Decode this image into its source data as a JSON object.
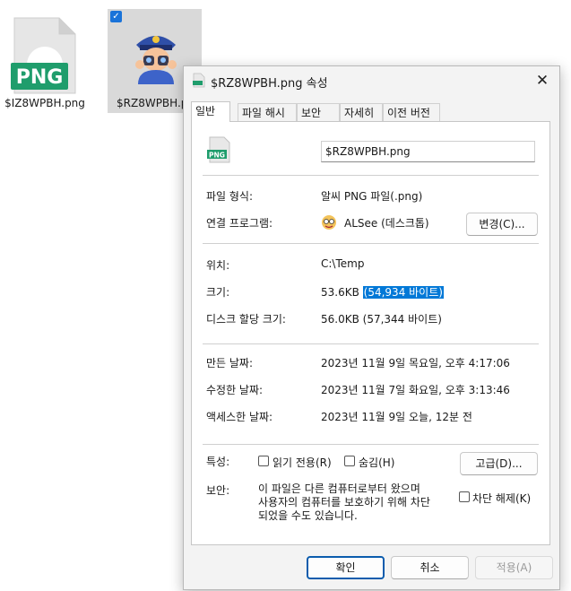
{
  "desktop": {
    "files": [
      {
        "name": "$IZ8WPBH.png",
        "badge": "PNG"
      },
      {
        "name": "$RZ8WPBH.png",
        "selected": true
      }
    ]
  },
  "dialog": {
    "title": "$RZ8WPBH.png 속성",
    "tabs": [
      {
        "label": "일반",
        "active": true
      },
      {
        "label": "파일 해시"
      },
      {
        "label": "보안"
      },
      {
        "label": "자세히"
      },
      {
        "label": "이전 버전"
      }
    ],
    "file_icon_text": "PNG",
    "filename": "$RZ8WPBH.png",
    "file_type_label": "파일 형식:",
    "file_type_value": "알씨 PNG 파일(.png)",
    "open_with_label": "연결 프로그램:",
    "open_with_value": "ALSee (데스크톱)",
    "change_button": "변경(C)...",
    "location_label": "위치:",
    "location_value": "C:\\Temp",
    "size_label": "크기:",
    "size_value": "53.6KB",
    "size_bytes": "(54,934 바이트)",
    "size_on_disk_label": "디스크 할당 크기:",
    "size_on_disk_value": "56.0KB (57,344 바이트)",
    "created_label": "만든 날짜:",
    "created_value": "2023년 11월 9일 목요일, 오후 4:17:06",
    "modified_label": "수정한 날짜:",
    "modified_value": "2023년 11월 7일 화요일, 오후 3:13:46",
    "accessed_label": "액세스한 날짜:",
    "accessed_value": "2023년 11월 9일 오늘, 12분 전",
    "attributes_label": "특성:",
    "readonly_label": "읽기 전용(R)",
    "hidden_label": "숨김(H)",
    "advanced_button": "고급(D)...",
    "security_label": "보안:",
    "security_text": [
      "이 파일은 다른 컴퓨터로부터 왔으며",
      "사용자의 컴퓨터를 보호하기 위해 차단",
      "되었을 수도 있습니다."
    ],
    "unblock_label": "차단 해제(K)",
    "ok_button": "확인",
    "cancel_button": "취소",
    "apply_button": "적용(A)",
    "colors": {
      "accent": "#0078d7",
      "png_green": "#1f9d6c"
    }
  }
}
